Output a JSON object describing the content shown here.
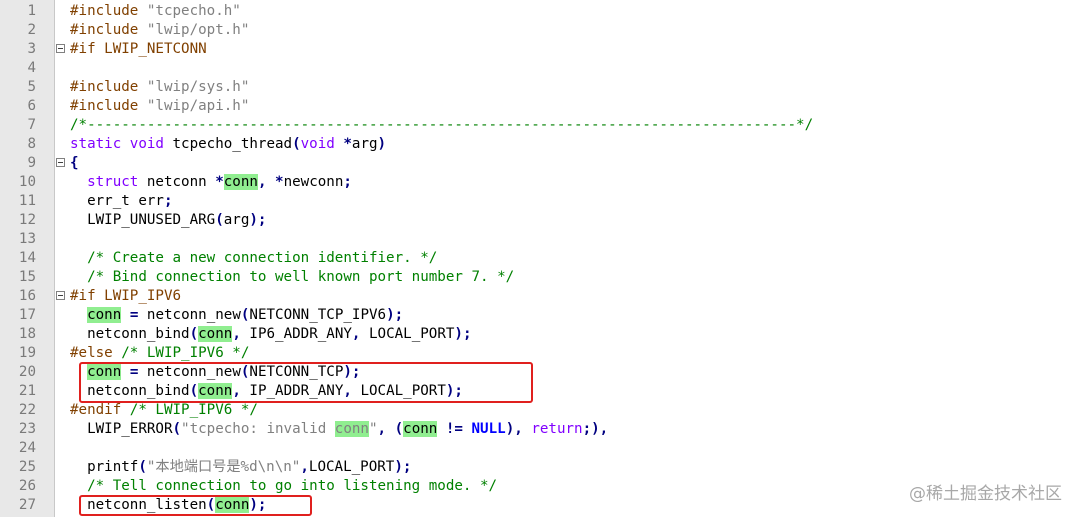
{
  "editor": {
    "colors": {
      "gutter": "#e8e8e8",
      "preprocessor": "#804000",
      "string": "#808080",
      "comment": "#008000",
      "keyword": "#8000ff",
      "number_constant": "#0000ff",
      "operator": "#000080",
      "highlight": "#90ee90",
      "annotation_box": "#e0201e"
    },
    "lines": [
      {
        "num": "1",
        "fold": false,
        "tokens": [
          [
            "pp",
            "#include "
          ],
          [
            "str",
            "\"tcpecho.h\""
          ]
        ]
      },
      {
        "num": "2",
        "fold": false,
        "tokens": [
          [
            "pp",
            "#include "
          ],
          [
            "str",
            "\"lwip/opt.h\""
          ]
        ]
      },
      {
        "num": "3",
        "fold": true,
        "tokens": [
          [
            "pp",
            "#if LWIP_NETCONN"
          ]
        ]
      },
      {
        "num": "4",
        "fold": false,
        "tokens": []
      },
      {
        "num": "5",
        "fold": false,
        "tokens": [
          [
            "pp",
            "#include "
          ],
          [
            "str",
            "\"lwip/sys.h\""
          ]
        ]
      },
      {
        "num": "6",
        "fold": false,
        "tokens": [
          [
            "pp",
            "#include "
          ],
          [
            "str",
            "\"lwip/api.h\""
          ]
        ]
      },
      {
        "num": "7",
        "fold": false,
        "tokens": [
          [
            "cm",
            "/*-----------------------------------------------------------------------------------*/"
          ]
        ]
      },
      {
        "num": "8",
        "fold": false,
        "tokens": [
          [
            "kw",
            "static"
          ],
          [
            "t",
            " "
          ],
          [
            "kw",
            "void"
          ],
          [
            "t",
            " tcpecho_thread"
          ],
          [
            "op",
            "("
          ],
          [
            "kw",
            "void"
          ],
          [
            "t",
            " "
          ],
          [
            "op",
            "*"
          ],
          [
            "t",
            "arg"
          ],
          [
            "op",
            ")"
          ]
        ]
      },
      {
        "num": "9",
        "fold": true,
        "tokens": [
          [
            "op",
            "{"
          ]
        ]
      },
      {
        "num": "10",
        "fold": false,
        "tokens": [
          [
            "t",
            "  "
          ],
          [
            "kw",
            "struct"
          ],
          [
            "t",
            " netconn "
          ],
          [
            "op",
            "*"
          ],
          [
            "hl",
            "conn"
          ],
          [
            "op",
            ","
          ],
          [
            "t",
            " "
          ],
          [
            "op",
            "*"
          ],
          [
            "t",
            "newconn"
          ],
          [
            "op",
            ";"
          ]
        ]
      },
      {
        "num": "11",
        "fold": false,
        "tokens": [
          [
            "t",
            "  err_t err"
          ],
          [
            "op",
            ";"
          ]
        ]
      },
      {
        "num": "12",
        "fold": false,
        "tokens": [
          [
            "t",
            "  LWIP_UNUSED_ARG"
          ],
          [
            "op",
            "("
          ],
          [
            "t",
            "arg"
          ],
          [
            "op",
            ");"
          ]
        ]
      },
      {
        "num": "13",
        "fold": false,
        "tokens": []
      },
      {
        "num": "14",
        "fold": false,
        "tokens": [
          [
            "t",
            "  "
          ],
          [
            "cm",
            "/* Create a new connection identifier. */"
          ]
        ]
      },
      {
        "num": "15",
        "fold": false,
        "tokens": [
          [
            "t",
            "  "
          ],
          [
            "cm",
            "/* Bind connection to well known port number 7. */"
          ]
        ]
      },
      {
        "num": "16",
        "fold": true,
        "tokens": [
          [
            "pp",
            "#if LWIP_IPV6"
          ]
        ]
      },
      {
        "num": "17",
        "fold": false,
        "tokens": [
          [
            "t",
            "  "
          ],
          [
            "hl",
            "conn"
          ],
          [
            "t",
            " "
          ],
          [
            "op",
            "="
          ],
          [
            "t",
            " netconn_new"
          ],
          [
            "op",
            "("
          ],
          [
            "t",
            "NETCONN_TCP_IPV6"
          ],
          [
            "op",
            ");"
          ]
        ]
      },
      {
        "num": "18",
        "fold": false,
        "tokens": [
          [
            "t",
            "  netconn_bind"
          ],
          [
            "op",
            "("
          ],
          [
            "hl",
            "conn"
          ],
          [
            "op",
            ","
          ],
          [
            "t",
            " IP6_ADDR_ANY"
          ],
          [
            "op",
            ","
          ],
          [
            "t",
            " LOCAL_PORT"
          ],
          [
            "op",
            ");"
          ]
        ]
      },
      {
        "num": "19",
        "fold": false,
        "tokens": [
          [
            "pp",
            "#else "
          ],
          [
            "cm",
            "/* LWIP_IPV6 */"
          ]
        ]
      },
      {
        "num": "20",
        "fold": false,
        "tokens": [
          [
            "t",
            "  "
          ],
          [
            "hl",
            "conn"
          ],
          [
            "t",
            " "
          ],
          [
            "op",
            "="
          ],
          [
            "t",
            " netconn_new"
          ],
          [
            "op",
            "("
          ],
          [
            "t",
            "NETCONN_TCP"
          ],
          [
            "op",
            ");"
          ]
        ]
      },
      {
        "num": "21",
        "fold": false,
        "tokens": [
          [
            "t",
            "  netconn_bind"
          ],
          [
            "op",
            "("
          ],
          [
            "hl",
            "conn"
          ],
          [
            "op",
            ","
          ],
          [
            "t",
            " IP_ADDR_ANY"
          ],
          [
            "op",
            ","
          ],
          [
            "t",
            " LOCAL_PORT"
          ],
          [
            "op",
            ");"
          ]
        ]
      },
      {
        "num": "22",
        "fold": false,
        "tokens": [
          [
            "pp",
            "#endif "
          ],
          [
            "cm",
            "/* LWIP_IPV6 */"
          ]
        ]
      },
      {
        "num": "23",
        "fold": false,
        "tokens": [
          [
            "t",
            "  LWIP_ERROR"
          ],
          [
            "op",
            "("
          ],
          [
            "str",
            "\"tcpecho: invalid "
          ],
          [
            "hlstr",
            "conn"
          ],
          [
            "str",
            "\""
          ],
          [
            "op",
            ","
          ],
          [
            "t",
            " "
          ],
          [
            "op",
            "("
          ],
          [
            "hl",
            "conn"
          ],
          [
            "t",
            " "
          ],
          [
            "op",
            "!="
          ],
          [
            "t",
            " "
          ],
          [
            "kb",
            "NULL"
          ],
          [
            "op",
            "),"
          ],
          [
            "t",
            " "
          ],
          [
            "kw",
            "return"
          ],
          [
            "op",
            ";),"
          ],
          [
            "t",
            ""
          ]
        ]
      },
      {
        "num": "24",
        "fold": false,
        "tokens": []
      },
      {
        "num": "25",
        "fold": false,
        "tokens": [
          [
            "t",
            "  printf"
          ],
          [
            "op",
            "("
          ],
          [
            "str",
            "\"本地端口号是%d\\n\\n\""
          ],
          [
            "op",
            ","
          ],
          [
            "t",
            "LOCAL_PORT"
          ],
          [
            "op",
            ");"
          ]
        ]
      },
      {
        "num": "26",
        "fold": false,
        "tokens": [
          [
            "t",
            "  "
          ],
          [
            "cm",
            "/* Tell connection to go into listening mode. */"
          ]
        ]
      },
      {
        "num": "27",
        "fold": false,
        "tokens": [
          [
            "t",
            "  netconn_listen"
          ],
          [
            "op",
            "("
          ],
          [
            "hl",
            "conn"
          ],
          [
            "op",
            ");"
          ]
        ]
      }
    ]
  },
  "watermark": "@稀土掘金技术社区"
}
